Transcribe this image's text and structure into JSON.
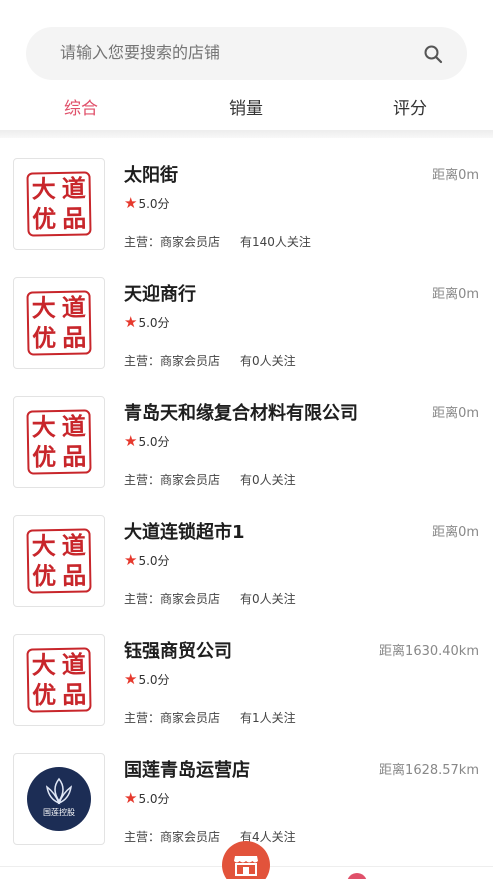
{
  "search": {
    "placeholder": "请输入您要搜索的店铺",
    "icon": "search-icon"
  },
  "tabs": [
    {
      "label": "综合",
      "active": true
    },
    {
      "label": "销量",
      "active": false
    },
    {
      "label": "评分",
      "active": false
    }
  ],
  "colors": {
    "accent": "#e0506a",
    "star": "#e63a2e",
    "seal": "#c8262b",
    "fab": "#e2533b"
  },
  "seal_logo": {
    "chars": [
      "大",
      "道",
      "优",
      "品"
    ]
  },
  "lotus_logo": {
    "text": "国莲控股"
  },
  "stores": [
    {
      "name": "太阳街",
      "distance": "距离0m",
      "rating": "5.0分",
      "main_business": "主营：商家会员店",
      "followers": "有140人关注",
      "logo": "seal"
    },
    {
      "name": "天迎商行",
      "distance": "距离0m",
      "rating": "5.0分",
      "main_business": "主营：商家会员店",
      "followers": "有0人关注",
      "logo": "seal"
    },
    {
      "name": "青岛天和缘复合材料有限公司",
      "distance": "距离0m",
      "rating": "5.0分",
      "main_business": "主营：商家会员店",
      "followers": "有0人关注",
      "logo": "seal"
    },
    {
      "name": "大道连锁超市1",
      "distance": "距离0m",
      "rating": "5.0分",
      "main_business": "主营：商家会员店",
      "followers": "有0人关注",
      "logo": "seal"
    },
    {
      "name": "钰强商贸公司",
      "distance": "距离1630.40km",
      "rating": "5.0分",
      "main_business": "主营：商家会员店",
      "followers": "有1人关注",
      "logo": "seal"
    },
    {
      "name": "国莲青岛运营店",
      "distance": "距离1628.57km",
      "rating": "5.0分",
      "main_business": "主营：商家会员店",
      "followers": "有4人关注",
      "logo": "lotus"
    }
  ]
}
